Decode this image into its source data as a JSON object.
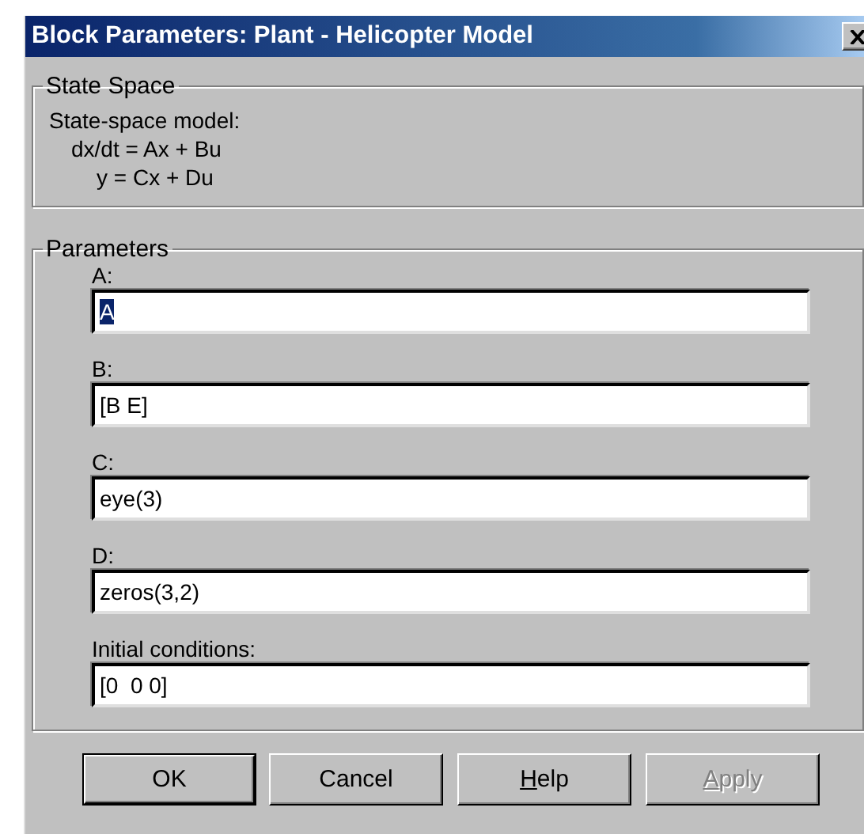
{
  "window": {
    "title": "Block Parameters: Plant - Helicopter Model"
  },
  "description": {
    "legend": "State Space",
    "lines": [
      "State-space model:",
      "dx/dt = Ax + Bu",
      "y = Cx + Du"
    ]
  },
  "parameters": {
    "legend": "Parameters",
    "fields": [
      {
        "label": "A:",
        "value": "A",
        "text_selected": true
      },
      {
        "label": "B:",
        "value": "[B E]",
        "text_selected": false
      },
      {
        "label": "C:",
        "value": "eye(3)",
        "text_selected": false
      },
      {
        "label": "D:",
        "value": "zeros(3,2)",
        "text_selected": false
      },
      {
        "label": "Initial conditions:",
        "value": "[0  0 0]",
        "text_selected": false
      }
    ]
  },
  "buttons": [
    {
      "label": "OK",
      "default": true,
      "disabled": false,
      "underline_first": false
    },
    {
      "label": "Cancel",
      "default": false,
      "disabled": false,
      "underline_first": false
    },
    {
      "label": "Help",
      "default": false,
      "disabled": false,
      "underline_first": true
    },
    {
      "label": "Apply",
      "default": false,
      "disabled": true,
      "underline_first": true
    }
  ]
}
